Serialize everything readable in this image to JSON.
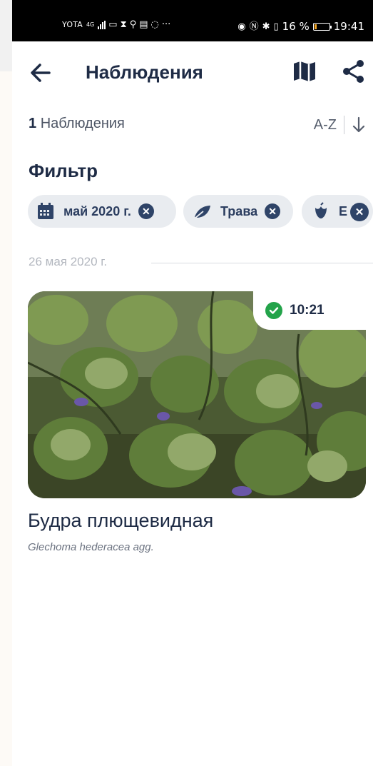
{
  "status_bar": {
    "carrier": "YOTA",
    "network": "4G",
    "battery": "16 %",
    "time": "19:41",
    "battery_level": 0.16
  },
  "app_bar": {
    "title": "Наблюдения",
    "icons": [
      "back-arrow-icon",
      "map-icon",
      "share-icon"
    ]
  },
  "summary": {
    "count": "1",
    "count_label": "Наблюдения",
    "sort_label": "A-Z",
    "sort_icon": "arrow-down-icon"
  },
  "filter": {
    "title": "Фильтр",
    "chips": [
      {
        "label": "май 2020 г.",
        "icon": "calendar-icon",
        "remove_icon": "close-icon"
      },
      {
        "label": "Трава",
        "icon": "leaf-icon",
        "remove_icon": "close-icon"
      },
      {
        "label": "Е",
        "icon": "flower-bud-icon",
        "remove_icon": "close-icon"
      }
    ]
  },
  "observations": {
    "date": "26 мая 2020 г.",
    "items": [
      {
        "time": "10:21",
        "verified_icon": "check-icon",
        "name": "Будра плющевидная",
        "latin": "Glechoma hederacea agg."
      }
    ]
  },
  "colors": {
    "primary_text": "#1e2b45",
    "chip_bg": "#e9ecf0",
    "chip_close": "#2f4468",
    "verified": "#23a34a",
    "status_bar": "#000000"
  }
}
